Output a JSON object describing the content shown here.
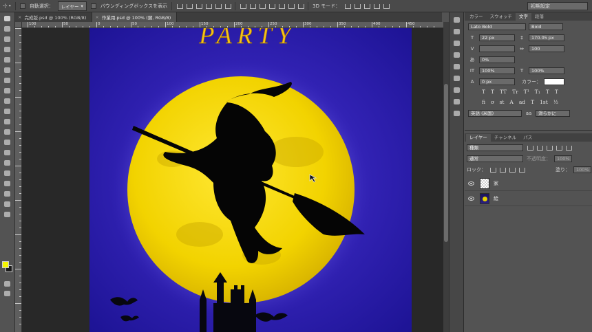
{
  "options_bar": {
    "auto_select_label": "自動選択：",
    "auto_select_target": "レイヤー",
    "bounding_box_label": "バウンディングボックスを表示",
    "mode_3d_label": "3D モード：",
    "workspace": "初期設定"
  },
  "tabs": [
    {
      "label": "完成版.psd @ 100% (RGB/8)",
      "close": "×"
    },
    {
      "label": "作業用.psd @ 100% (鍵, RGB/8)",
      "close": "×"
    }
  ],
  "rulers": {
    "top": [
      "100",
      "50",
      "0",
      "50",
      "100",
      "150",
      "200",
      "250",
      "300",
      "350",
      "400",
      "450",
      "500",
      "550",
      "600"
    ]
  },
  "artwork": {
    "title": "PARTY",
    "sky_color": "#1e148c",
    "moon_color": "#f0d800",
    "title_color": "#f2c21a"
  },
  "swatches": {
    "foreground": "#f6f600",
    "background": "#1b1b1b"
  },
  "character_panel": {
    "tabs": [
      "カラー",
      "スウォッチ",
      "文字",
      "段落"
    ],
    "active_tab": "文字",
    "font_family": "Lato Bold",
    "font_style": "Bold",
    "font_size": "22 px",
    "leading": "170.05 px",
    "tracking": "100",
    "scale_pct": "0%",
    "vertical_scale": "100%",
    "horizontal_scale": "100%",
    "baseline_shift": "0 px",
    "color_label": "カラー：",
    "glyph_buttons": [
      "T",
      "T",
      "TT",
      "Tr",
      "T¹",
      "T₁",
      "T",
      "T"
    ],
    "opentype_buttons": [
      "fi",
      "ơ",
      "st",
      "A",
      "ad",
      "T",
      "1st",
      "½"
    ],
    "language": "英語 (米国)",
    "antialias_label": "aa",
    "antialias": "滑らかに"
  },
  "layers_panel": {
    "tabs": [
      "レイヤー",
      "チャンネル",
      "パス"
    ],
    "active_tab": "レイヤー",
    "filter_kind": "種類",
    "blend_mode": "通常",
    "opacity_label": "不透明度：",
    "opacity_value": "100%",
    "lock_label": "ロック：",
    "fill_label": "塗り：",
    "fill_value": "100%",
    "layers": [
      {
        "name": "家",
        "visible": true
      },
      {
        "name": "絵",
        "visible": true
      }
    ]
  }
}
